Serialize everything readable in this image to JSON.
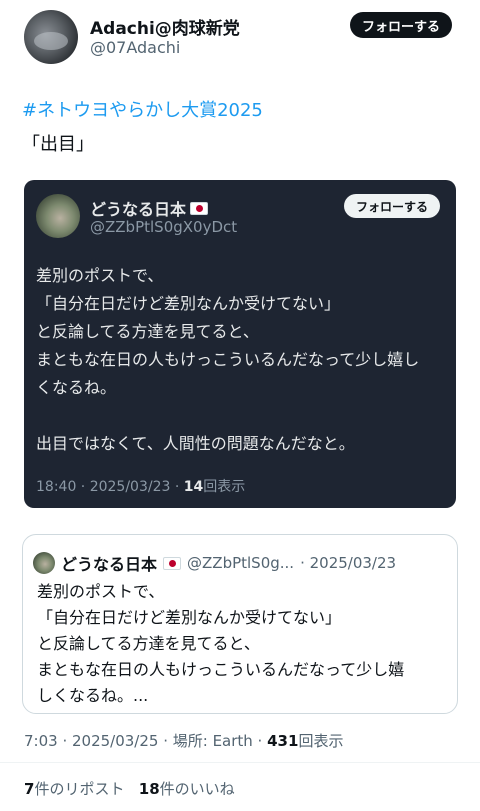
{
  "author": {
    "display_name": "Adachi@肉球新党",
    "handle": "@07Adachi",
    "follow_label": "フォローする"
  },
  "post": {
    "hashtag": "#ネトウヨやらかし大賞2025",
    "text": "「出目」"
  },
  "embedded_screenshot": {
    "display_name": "どうなる日本",
    "handle": "@ZZbPtlS0gX0yDct",
    "follow_label": "フォローする",
    "lines": [
      "差別のポストで、",
      "「自分在日だけど差別なんか受けてない」",
      "と反論してる方達を見てると、",
      "まともな在日の人もけっこういるんだなって少し嬉し",
      "くなるね。",
      "",
      "出目ではなくて、人間性の問題なんだなと。"
    ],
    "time": "18:40 · 2025/03/23 ·",
    "views_count": "14",
    "views_label": "回表示"
  },
  "quote": {
    "display_name": "どうなる日本",
    "handle": "@ZZbPtlS0g...",
    "date": "· 2025/03/23",
    "lines": [
      "差別のポストで、",
      "「自分在日だけど差別なんか受けてない」",
      "と反論してる方達を見てると、",
      "まともな在日の人もけっこういるんだなって少し嬉",
      "しくなるね。..."
    ]
  },
  "meta": {
    "time": "7:03 · 2025/03/25 · 場所: Earth ·",
    "views_count": "431",
    "views_label": "回表示"
  },
  "stats": {
    "reposts_count": "7",
    "reposts_label": "件のリポスト",
    "likes_count": "18",
    "likes_label": "件のいいね"
  },
  "icons": {
    "flag": "japan-flag-icon"
  }
}
